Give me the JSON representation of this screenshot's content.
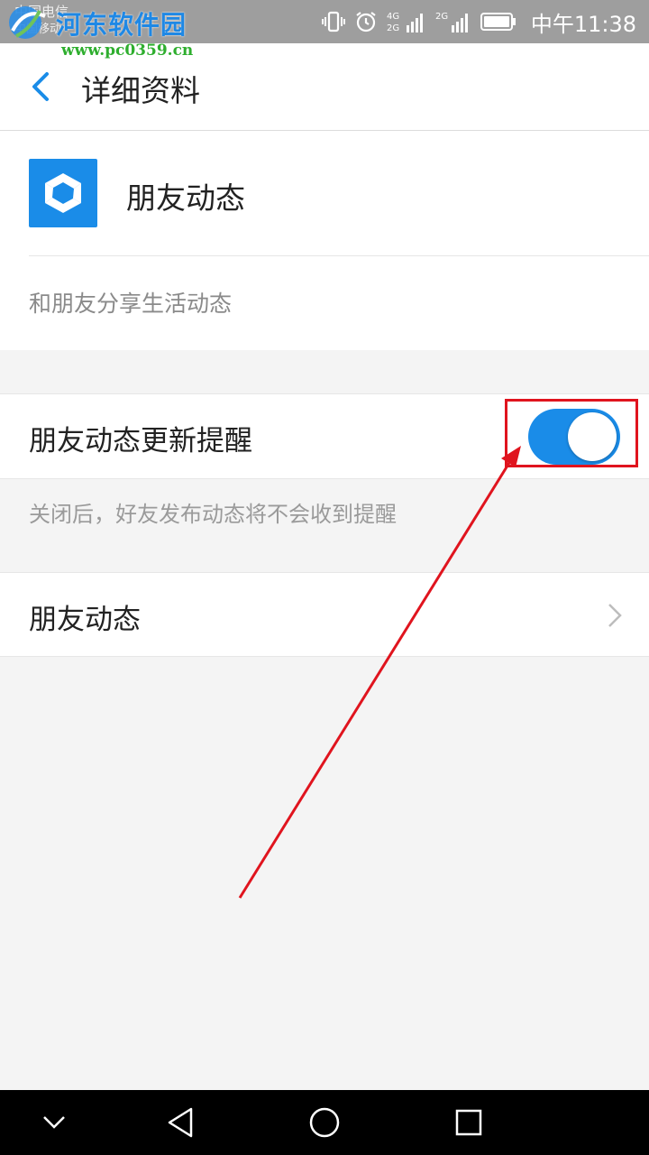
{
  "status_bar": {
    "carrier_line1": "中国电信",
    "carrier_line2": "中国移动",
    "network_1": "4G",
    "network_1b": "2G",
    "network_2": "2G",
    "time": "中午11:38"
  },
  "watermark": {
    "text": "河东软件园",
    "url": "www.pc0359.cn"
  },
  "header": {
    "title": "详细资料"
  },
  "app": {
    "name": "朋友动态",
    "description": "和朋友分享生活动态"
  },
  "settings": {
    "toggle_label": "朋友动态更新提醒",
    "toggle_on": true,
    "hint": "关闭后，好友发布动态将不会收到提醒",
    "nav_label": "朋友动态"
  },
  "colors": {
    "accent": "#1a8ce8",
    "annotation": "#e0141e"
  }
}
